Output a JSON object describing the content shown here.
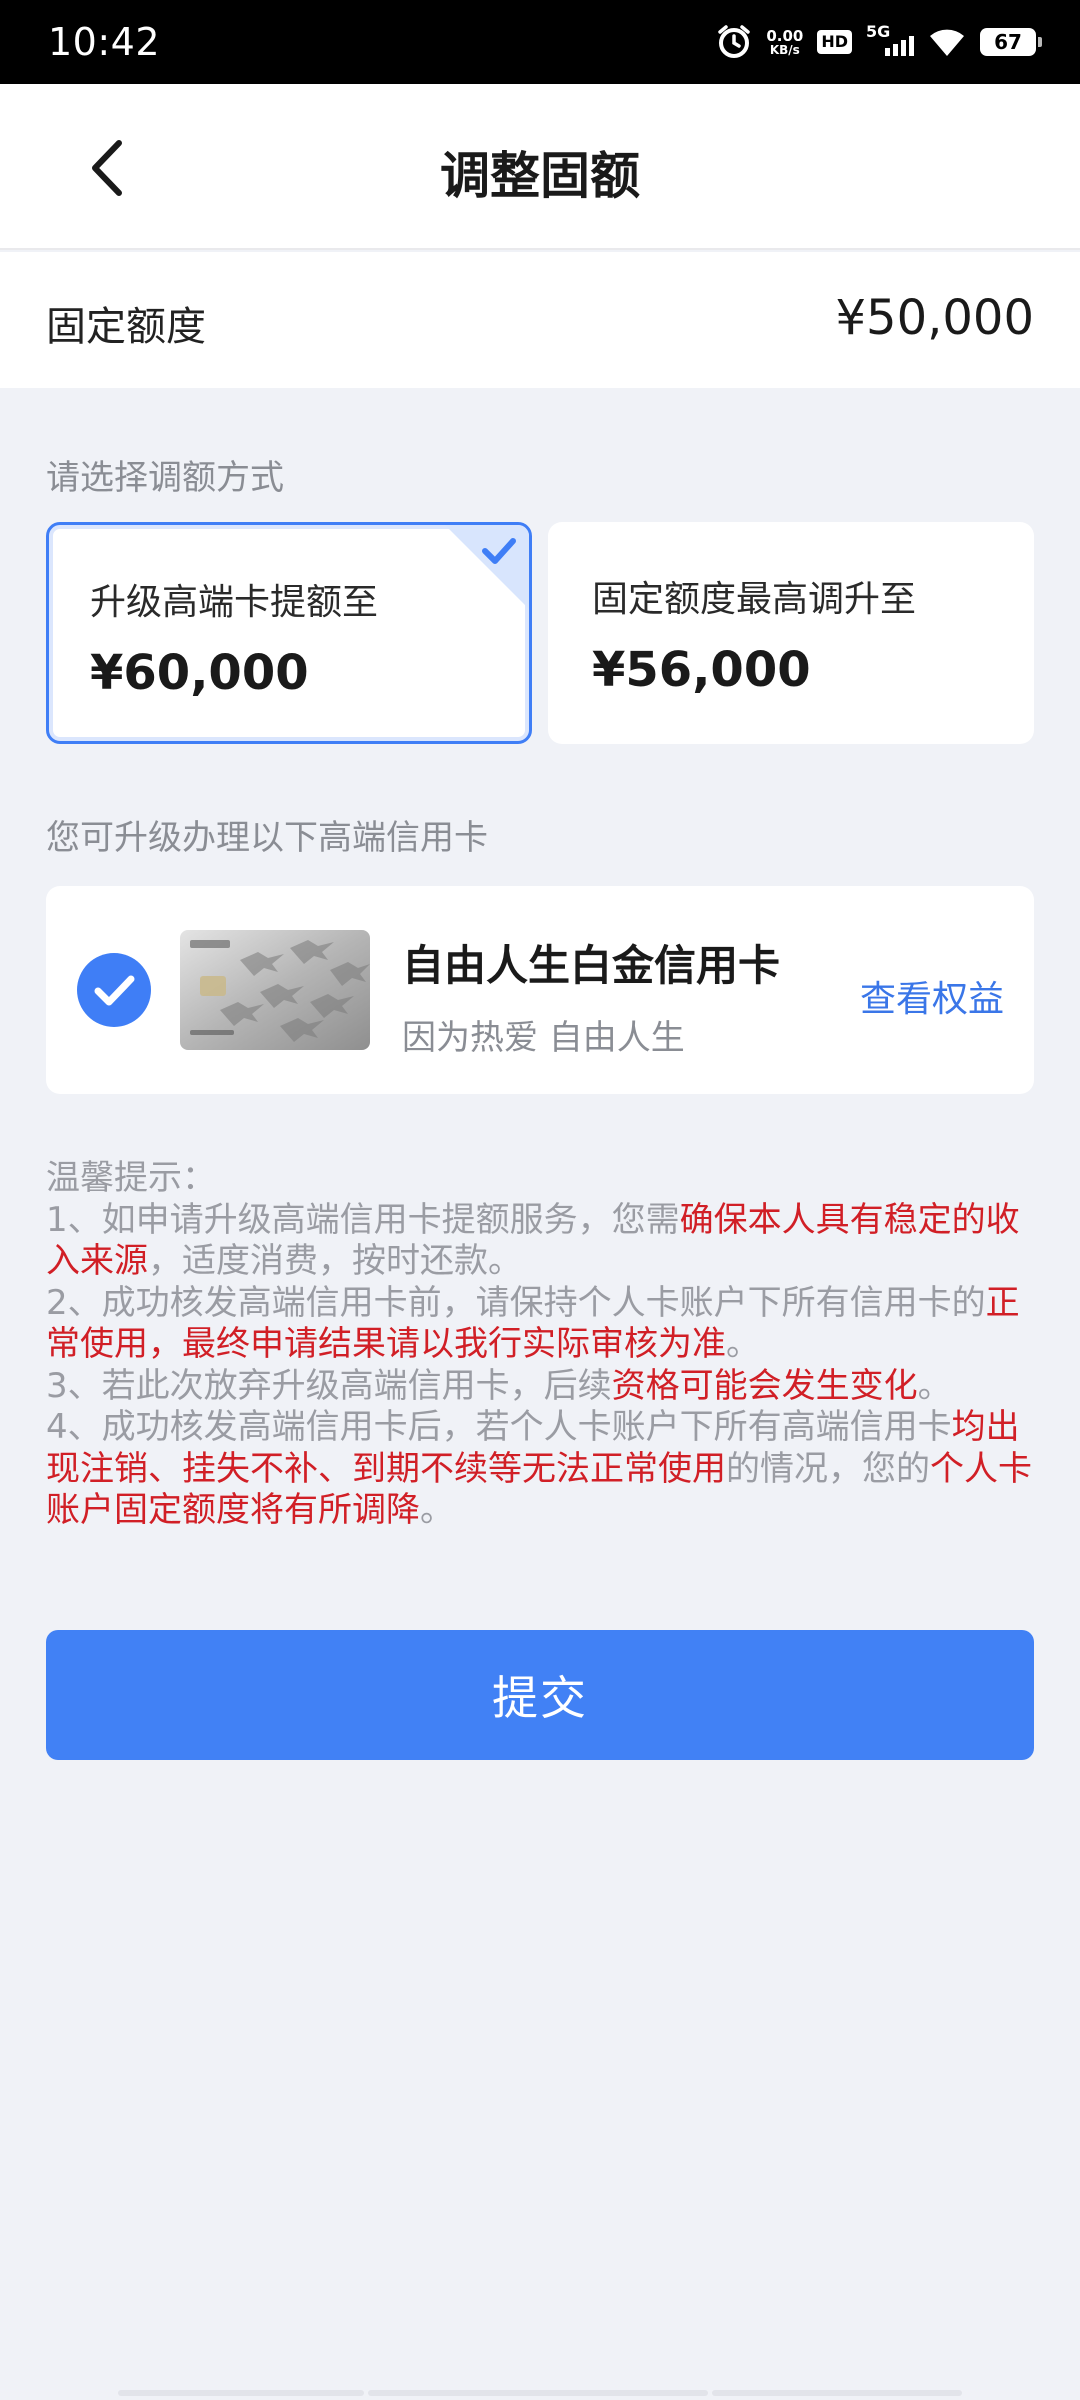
{
  "status_bar": {
    "time": "10:42",
    "net_speed_value": "0.00",
    "net_speed_unit": "KB/s",
    "hd_label": "HD",
    "network_label": "5G",
    "battery": "67",
    "icons": [
      "alarm-icon",
      "hd-icon",
      "signal-icon",
      "wifi-icon",
      "battery-icon"
    ]
  },
  "nav": {
    "back_icon": "chevron-left-icon",
    "title": "调整固额"
  },
  "quota": {
    "label": "固定额度",
    "value": "¥50,000"
  },
  "method_section": {
    "label": "请选择调额方式",
    "options": [
      {
        "title": "升级高端卡提额至",
        "amount": "¥60,000",
        "selected": true
      },
      {
        "title": "固定额度最高调升至",
        "amount": "¥56,000",
        "selected": false
      }
    ]
  },
  "upgrade_section": {
    "label": "您可升级办理以下高端信用卡",
    "card": {
      "name": "自由人生白金信用卡",
      "slogan": "因为热爱 自由人生",
      "link": "查看权益",
      "checked": true
    }
  },
  "tips": {
    "heading": "温馨提示：",
    "items": [
      [
        "1、如申请升级高端信用卡提额服务，您需",
        "确保本人具有稳定的收入来源",
        "，适度消费，按时还款。"
      ],
      [
        "2、成功核发高端信用卡前，请保持个人卡账户下所有信用卡的",
        "正常使用，最终申请结果请以我行实际审核为准",
        "。"
      ],
      [
        "3、若此次放弃升级高端信用卡，后续",
        "资格可能会发生变化",
        "。"
      ],
      [
        "4、成功核发高端信用卡后，若个人卡账户下所有高端信用卡",
        "均出现注销、挂失不补、到期不续等无法正常使用",
        "的情况，您的",
        "个人卡账户固定额度将有所调降",
        "。"
      ]
    ]
  },
  "submit": {
    "label": "提交"
  },
  "colors": {
    "accent": "#4181f5",
    "link": "#3a76e8",
    "warning_red": "#d11f26",
    "background": "#f0f2f7"
  }
}
